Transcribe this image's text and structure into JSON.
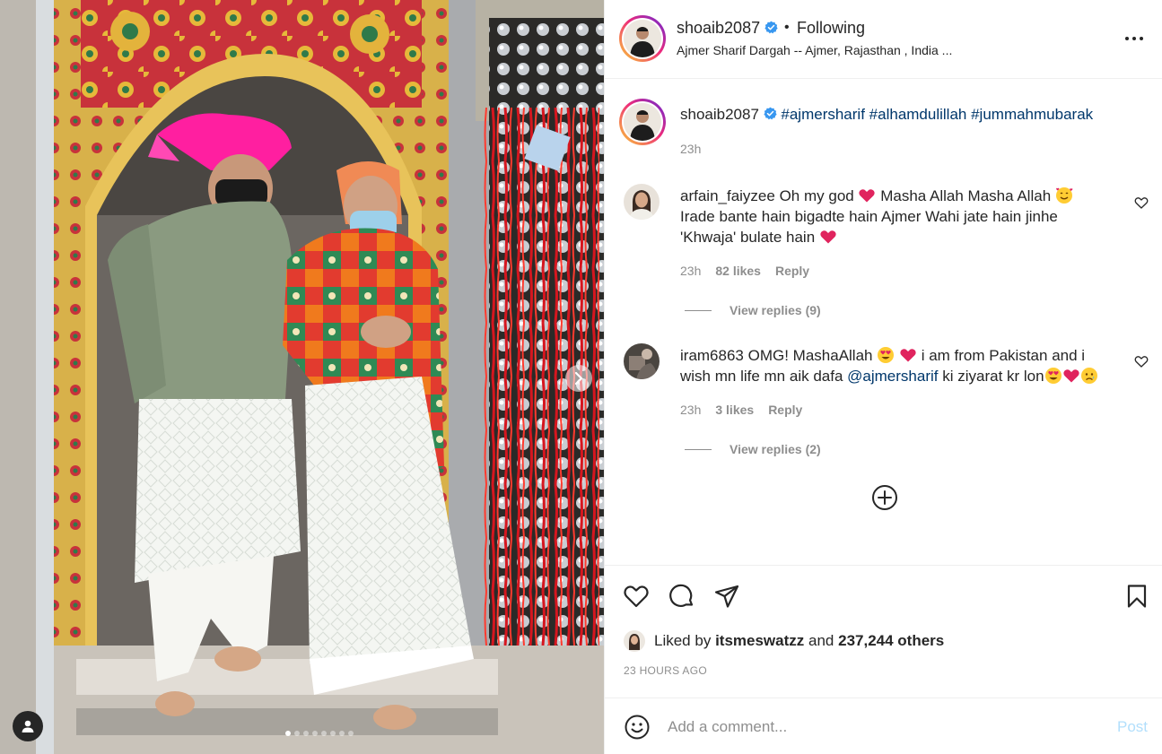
{
  "post": {
    "username": "shoaib2087",
    "separator": "•",
    "follow_status": "Following",
    "location": "Ajmer Sharif Dargah -- Ajmer, Rajasthan , India ...",
    "more_icon": "more-horizontal-icon",
    "verified_icon": "verified-badge-icon",
    "carousel": {
      "current": 1,
      "total": 8
    }
  },
  "caption": {
    "username": "shoaib2087",
    "hashtags": [
      "#ajmersharif",
      "#alhamdulillah",
      "#jummahmubarak"
    ],
    "time": "23h"
  },
  "comments": [
    {
      "username": "arfain_faiyzee",
      "text_1": "Oh my god",
      "text_2": "Masha Allah Masha Allah",
      "text_3": "Irade bante hain bigadte hain Ajmer Wahi jate hain jinhe 'Khwaja' bulate hain",
      "time": "23h",
      "likes": "82 likes",
      "reply_label": "Reply",
      "view_replies": "View replies (9)"
    },
    {
      "username": "iram6863",
      "text_1": "OMG! MashaAllah",
      "text_2": "i am from Pakistan and i wish mn life mn aik dafa",
      "mention": "@ajmersharif",
      "text_3": "ki ziyarat kr lon",
      "time": "23h",
      "likes": "3 likes",
      "reply_label": "Reply",
      "view_replies": "View replies (2)"
    }
  ],
  "actions": {
    "like_icon": "heart-icon",
    "comment_icon": "comment-bubble-icon",
    "share_icon": "paper-plane-icon",
    "save_icon": "bookmark-icon",
    "load_more_icon": "plus-circle-icon"
  },
  "likes": {
    "prefix": "Liked by",
    "user": "itsmeswatzz",
    "middle": "and",
    "others": "237,244 others",
    "time_ago": "23 HOURS AGO"
  },
  "add_comment": {
    "placeholder": "Add a comment...",
    "post_label": "Post",
    "emoji_icon": "smiley-icon"
  },
  "colors": {
    "link": "#00376b",
    "verified": "#3897f0",
    "secondary_text": "#8e8e8e",
    "post_disabled": "#b2dffc",
    "heart_red": "#e0245e"
  }
}
